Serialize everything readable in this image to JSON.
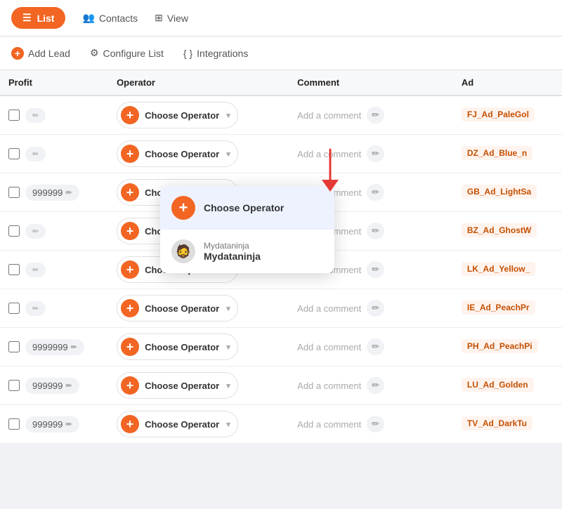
{
  "nav": {
    "list_label": "List",
    "contacts_label": "Contacts",
    "view_label": "View"
  },
  "toolbar": {
    "add_lead_label": "Add Lead",
    "configure_list_label": "Configure List",
    "integrations_label": "Integrations"
  },
  "table": {
    "headers": [
      "Profit",
      "Operator",
      "Comment",
      "Ad"
    ],
    "comment_placeholder": "Add a comment",
    "rows": [
      {
        "profit": "",
        "operator": "Choose Operator",
        "comment": "",
        "ad": "FJ_Ad_PaleGol"
      },
      {
        "profit": "",
        "operator": "Choose Operator",
        "comment": "",
        "ad": "DZ_Ad_Blue_n"
      },
      {
        "profit": "999999",
        "operator": "Choose Operator",
        "comment": "",
        "ad": "GB_Ad_LightSa"
      },
      {
        "profit": "",
        "operator": "Choose Operator",
        "comment": "",
        "ad": "BZ_Ad_GhostW"
      },
      {
        "profit": "",
        "operator": "Choose Operator",
        "comment": "",
        "ad": "LK_Ad_Yellow_"
      },
      {
        "profit": "",
        "operator": "Choose Operator",
        "comment": "",
        "ad": "IE_Ad_PeachPr"
      },
      {
        "profit": "9999999",
        "operator": "Choose Operator",
        "comment": "",
        "ad": "PH_Ad_PeachPi"
      },
      {
        "profit": "999999",
        "operator": "Choose Operator",
        "comment": "",
        "ad": "LU_Ad_Golden"
      },
      {
        "profit": "999999",
        "operator": "Choose Operator",
        "comment": "",
        "ad": "TV_Ad_DarkTu"
      }
    ]
  },
  "dropdown": {
    "items": [
      {
        "type": "add",
        "label": "Choose Operator",
        "sub": ""
      },
      {
        "type": "user",
        "label": "Mydataninja",
        "sub": "Mydataninja",
        "avatar_emoji": "🧔"
      }
    ]
  },
  "colors": {
    "orange": "#f26522",
    "highlight": "#eef2ff"
  }
}
